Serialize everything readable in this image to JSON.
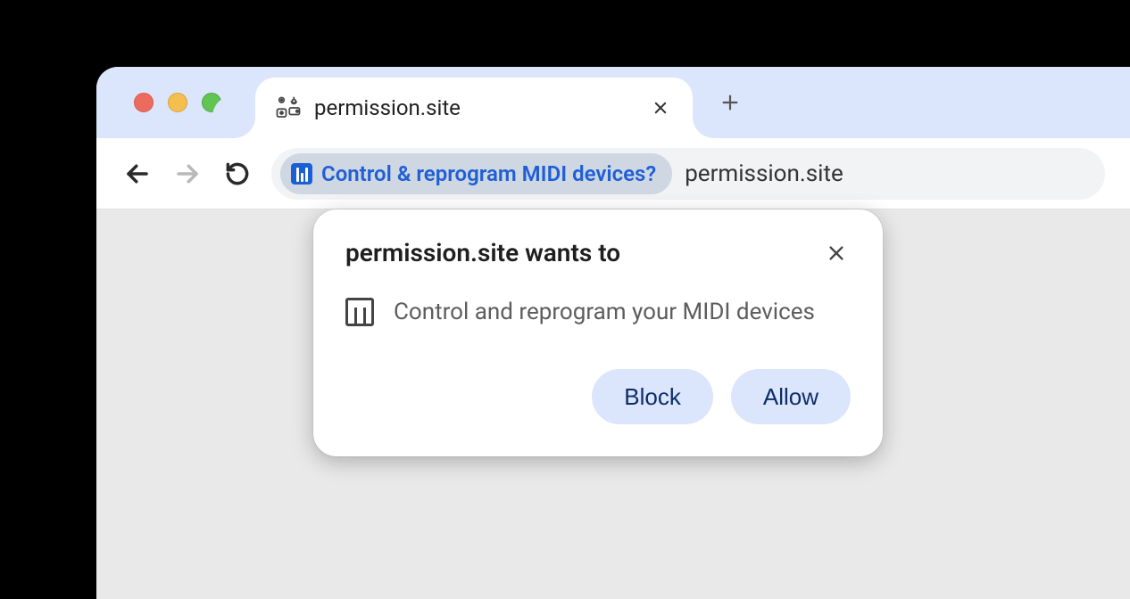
{
  "tab": {
    "title": "permission.site"
  },
  "omnibox": {
    "chip_text": "Control & reprogram MIDI devices?",
    "url": "permission.site"
  },
  "dialog": {
    "title": "permission.site wants to",
    "permission_text": "Control and reprogram your MIDI devices",
    "block_label": "Block",
    "allow_label": "Allow"
  }
}
